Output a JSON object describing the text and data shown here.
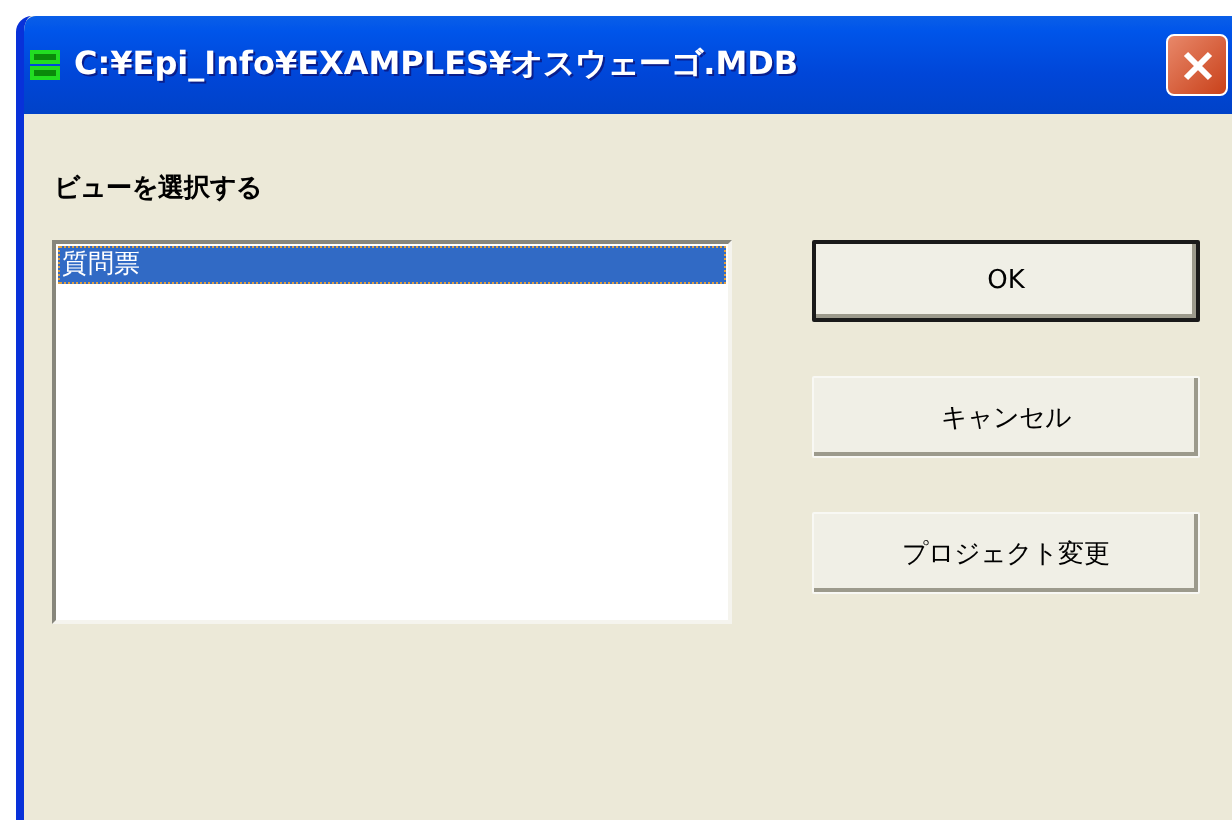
{
  "window": {
    "title": "C:¥Epi_Info¥EXAMPLES¥オスウェーゴ.MDB"
  },
  "label": "ビューを選択する",
  "views": [
    {
      "name": "質問票",
      "selected": true
    }
  ],
  "buttons": [
    {
      "label": "OK",
      "default": true
    },
    {
      "label": "キャンセル",
      "default": false
    },
    {
      "label": "プロジェクト変更",
      "default": false
    }
  ]
}
